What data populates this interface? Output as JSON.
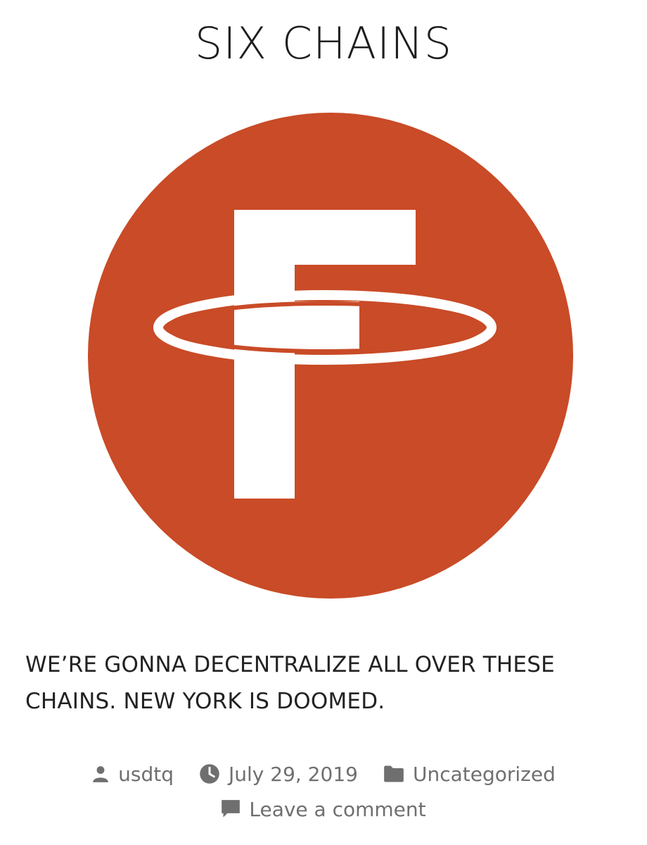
{
  "post": {
    "title": "SIX CHAINS",
    "excerpt": "WE’RE GONNA DECENTRALIZE ALL OVER THESE CHAINS. NEW YORK IS DOOMED.",
    "meta": {
      "author": "usdtq",
      "date": "July 29, 2019",
      "category": "Uncategorized",
      "comment_link": "Leave a comment"
    }
  },
  "colors": {
    "logo_background": "#c94b27",
    "logo_glyph": "#ffffff",
    "meta_text": "#6f6f6f"
  },
  "icons": {
    "author": "person-icon",
    "date": "clock-icon",
    "category": "folder-icon",
    "comment": "comment-bubble-icon"
  }
}
